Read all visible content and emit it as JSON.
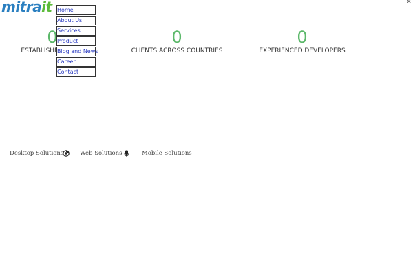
{
  "brand": {
    "logo_main": "mitra",
    "logo_accent": "it"
  },
  "close": {
    "glyph": "✕"
  },
  "nav": {
    "items": [
      {
        "label": "Home"
      },
      {
        "label": "About Us"
      },
      {
        "label": "Services"
      },
      {
        "label": "Product"
      },
      {
        "label": "Blog and News"
      },
      {
        "label": "Career"
      },
      {
        "label": "Contact"
      }
    ]
  },
  "stats": [
    {
      "value": "0",
      "label": "ESTABLISHED SINCE"
    },
    {
      "value": "0",
      "label": "CLIENTS ACROSS COUNTRIES"
    },
    {
      "value": "0",
      "label": "EXPERIENCED DEVELOPERS"
    }
  ],
  "solutions": {
    "desktop": "Desktop Solutions",
    "web": "Web Solutions",
    "mobile": "Mobile Solutions",
    "icon_1": "circle-logo-icon",
    "icon_2": "mobile-device-icon"
  },
  "colors": {
    "logo_blue": "#2a7fc0",
    "logo_green": "#5cbb3a",
    "stat_green": "#5cb86a",
    "nav_link": "#2a3bc0"
  }
}
